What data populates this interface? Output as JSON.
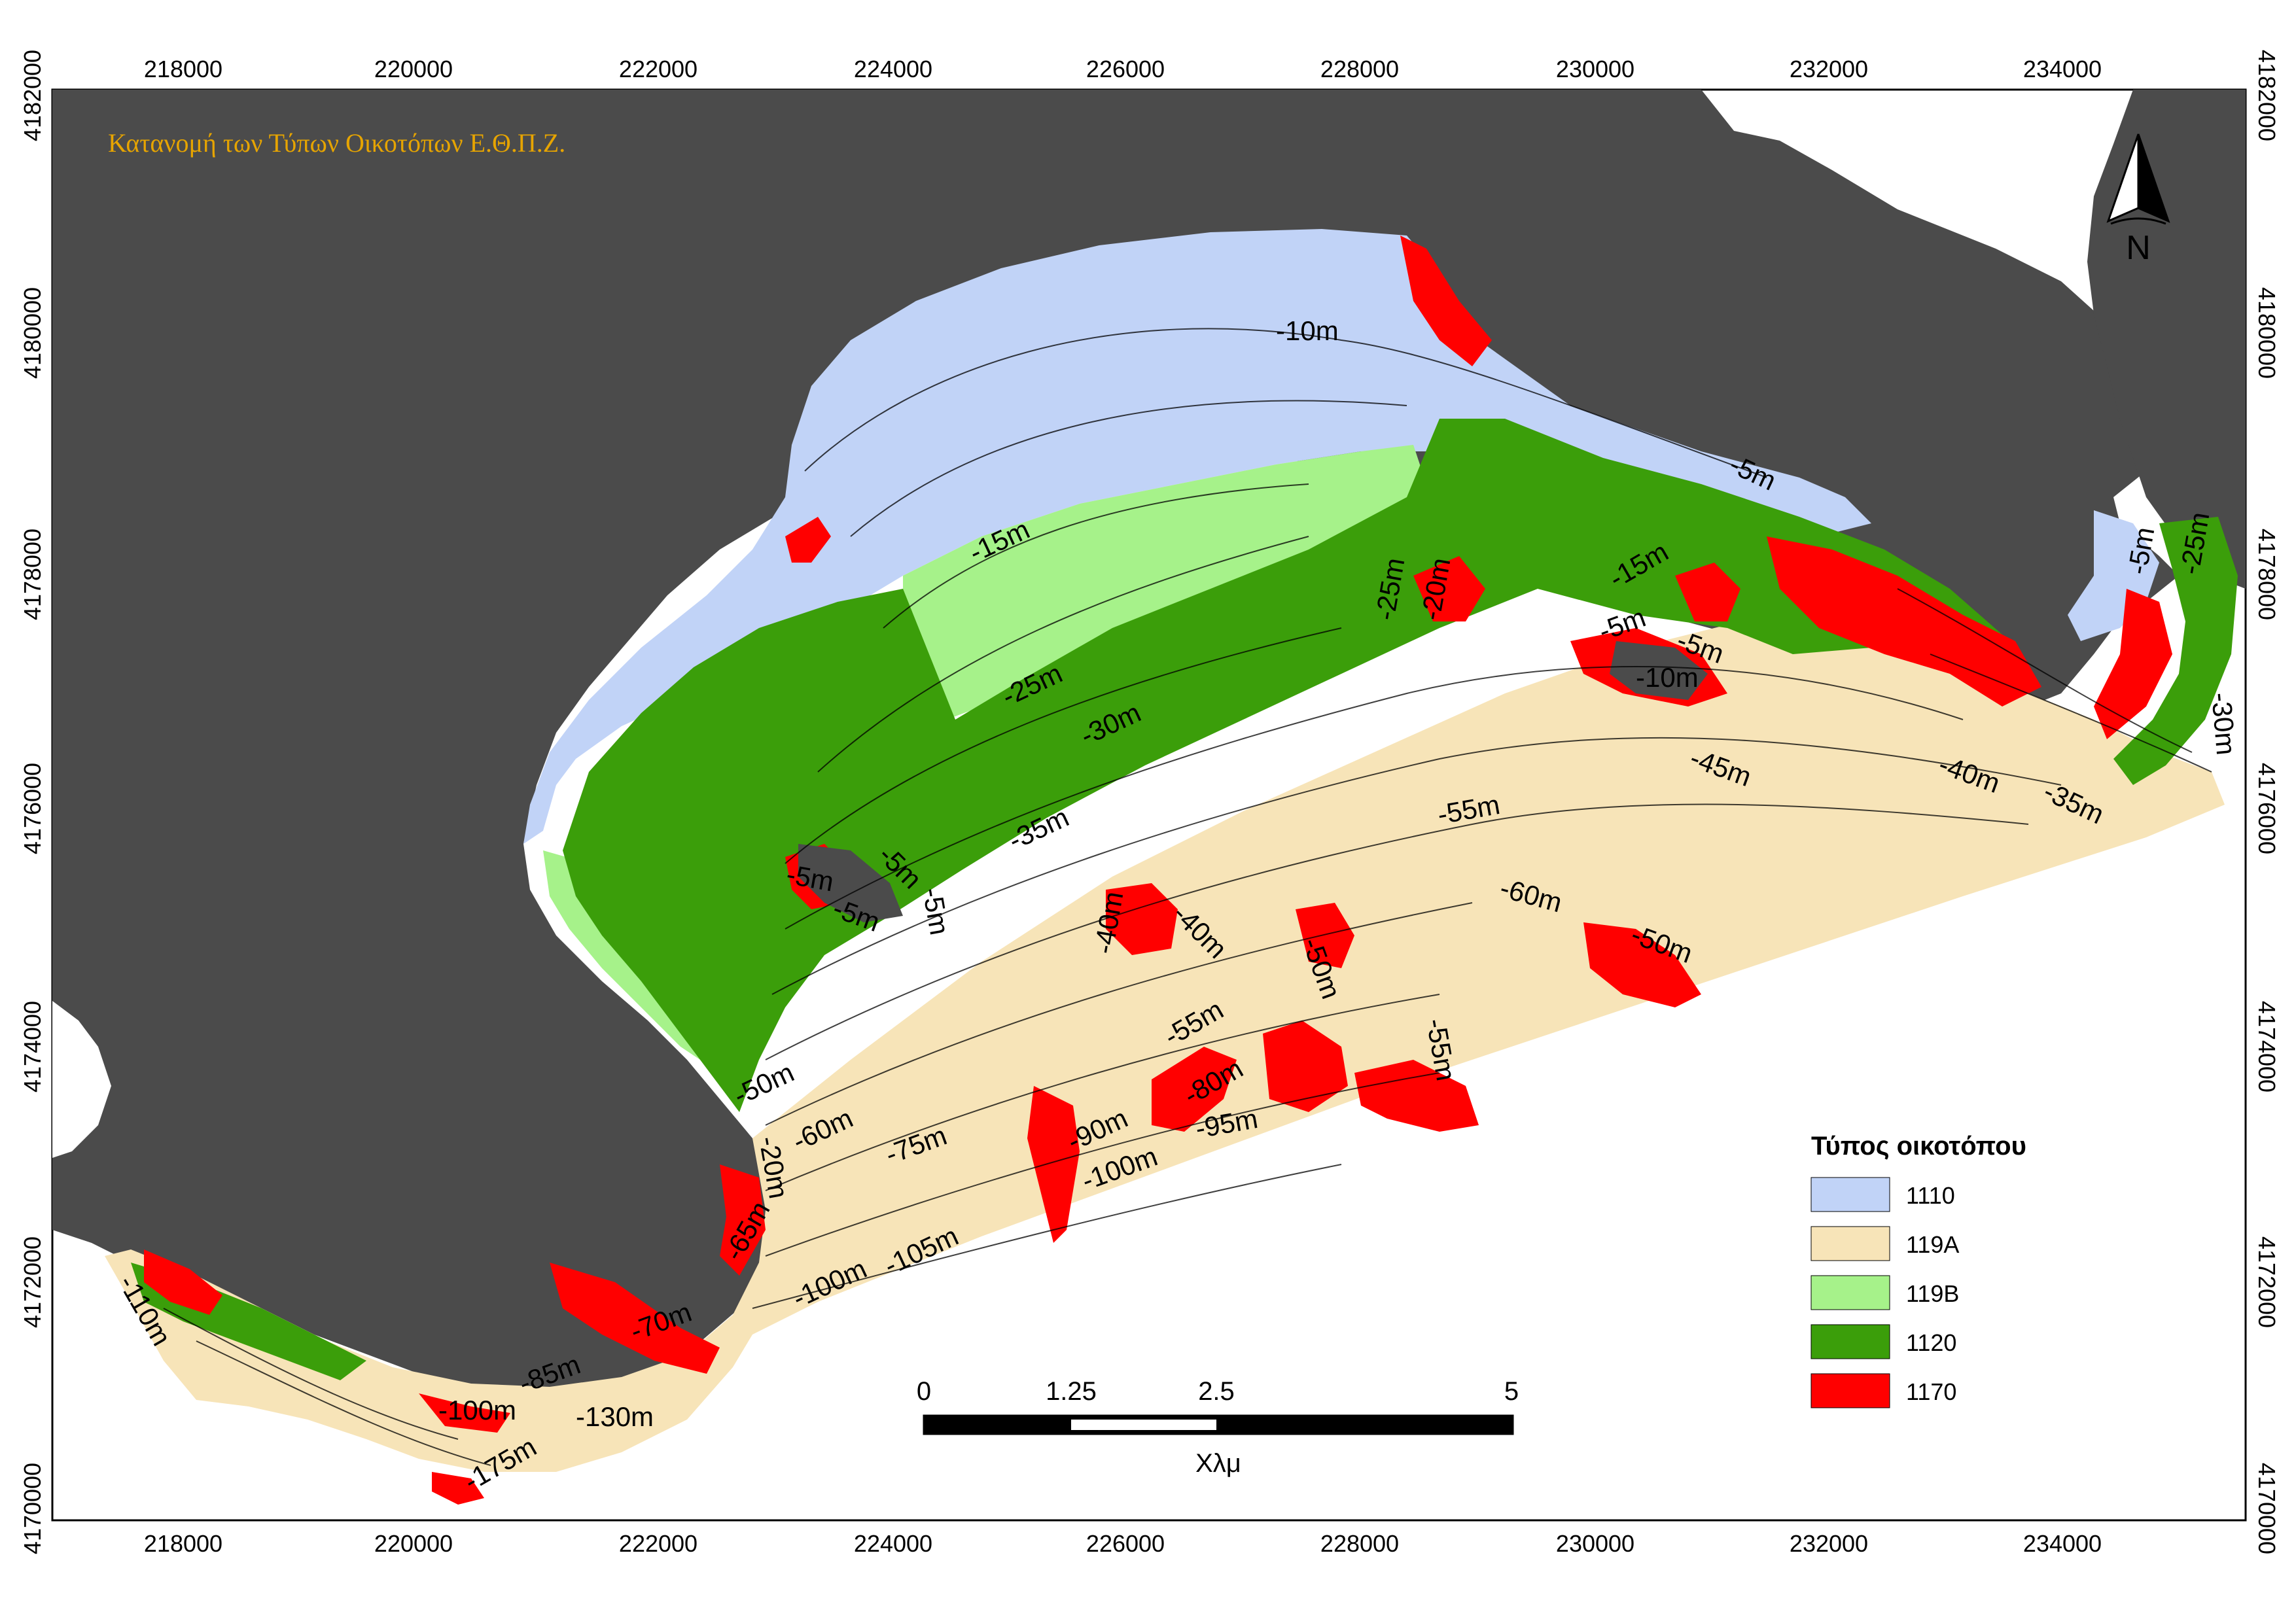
{
  "title": "Κατανομή των Τύπων Οικοτόπων Ε.Θ.Π.Ζ.",
  "colors": {
    "land": "#4b4b4b",
    "sea_outside": "#ffffff",
    "title_color": "#e6a400",
    "h1110": "#c1d3f7",
    "h119A": "#f7e4b8",
    "h119B": "#a6f28a",
    "h1120": "#3b9e0a",
    "h1170": "#ff0000"
  },
  "axes": {
    "x_ticks": [
      "218000",
      "220000",
      "222000",
      "224000",
      "226000",
      "228000",
      "230000",
      "232000",
      "234000"
    ],
    "y_ticks": [
      "4182000",
      "4180000",
      "4178000",
      "4176000",
      "4174000",
      "4172000",
      "4170000"
    ]
  },
  "north_arrow": {
    "label": "N",
    "icon": "north-arrow-icon"
  },
  "legend": {
    "title": "Τύπος οικοτόπου",
    "items": [
      {
        "code": "1110",
        "color": "#c1d3f7"
      },
      {
        "code": "119A",
        "color": "#f7e4b8"
      },
      {
        "code": "119B",
        "color": "#a6f28a"
      },
      {
        "code": "1120",
        "color": "#3b9e0a"
      },
      {
        "code": "1170",
        "color": "#ff0000"
      }
    ]
  },
  "scale_bar": {
    "ticks": [
      "0",
      "1.25",
      "2.5",
      "5"
    ],
    "unit": "Χλμ"
  },
  "contour_labels": [
    "-10m",
    "-5m",
    "-15m",
    "-25m",
    "-30m",
    "-35m",
    "-25m",
    "-20m",
    "-15m",
    "-5m",
    "-5m",
    "-10m",
    "-45m",
    "-40m",
    "-35m",
    "-30m",
    "-25m",
    "-5m",
    "-55m",
    "-60m",
    "-50m",
    "-50m",
    "-40m",
    "-40m",
    "-55m",
    "-55m",
    "-80m",
    "-95m",
    "-90m",
    "-100m",
    "-75m",
    "-60m",
    "-50m",
    "-20m",
    "-65m",
    "-100m",
    "-105m",
    "-70m",
    "-85m",
    "-100m",
    "-130m",
    "-175m",
    "-110m",
    "-5m",
    "-5m",
    "-5m",
    "-5m"
  ]
}
